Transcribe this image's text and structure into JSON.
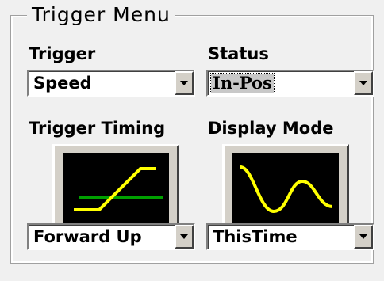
{
  "group": {
    "title": "Trigger Menu"
  },
  "trigger": {
    "label": "Trigger",
    "value": "Speed"
  },
  "status": {
    "label": "Status",
    "value": "In-Pos"
  },
  "timing": {
    "label": "Trigger Timing",
    "value": "Forward Up",
    "icon": "trigger-up-curve-icon"
  },
  "display": {
    "label": "Display Mode",
    "value": "ThisTime",
    "icon": "sine-wave-icon"
  },
  "colors": {
    "wave": "#ffff00",
    "level": "#00a000",
    "screen": "#000000"
  }
}
